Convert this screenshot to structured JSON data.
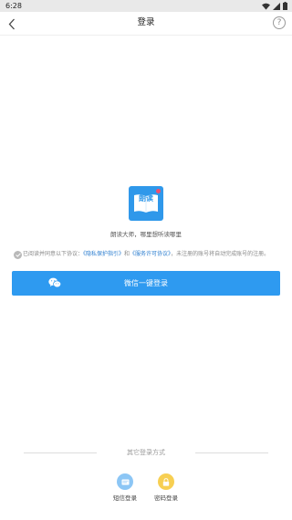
{
  "status_bar": {
    "time": "6:28"
  },
  "header": {
    "title": "登录",
    "help": "?"
  },
  "logo": {
    "text": "朗读"
  },
  "slogan": "朗读大师，哪里想听读哪里",
  "agreement": {
    "prefix": "已阅读并同意以下协议：",
    "privacy_link": "《隐私保护指引》",
    "and": "和",
    "service_link": "《服务许可协议》",
    "suffix": "，未注册的账号将自动完成账号的注册。"
  },
  "wechat_button": {
    "label": "微信一键登录"
  },
  "other_login": {
    "title": "其它登录方式",
    "options": [
      {
        "label": "短信登录",
        "icon": "message-icon"
      },
      {
        "label": "密码登录",
        "icon": "lock-icon"
      }
    ]
  },
  "colors": {
    "primary": "#2e9af0",
    "link": "#2e7fd0",
    "sms": "#8cc6f5",
    "password": "#f7cf52"
  }
}
